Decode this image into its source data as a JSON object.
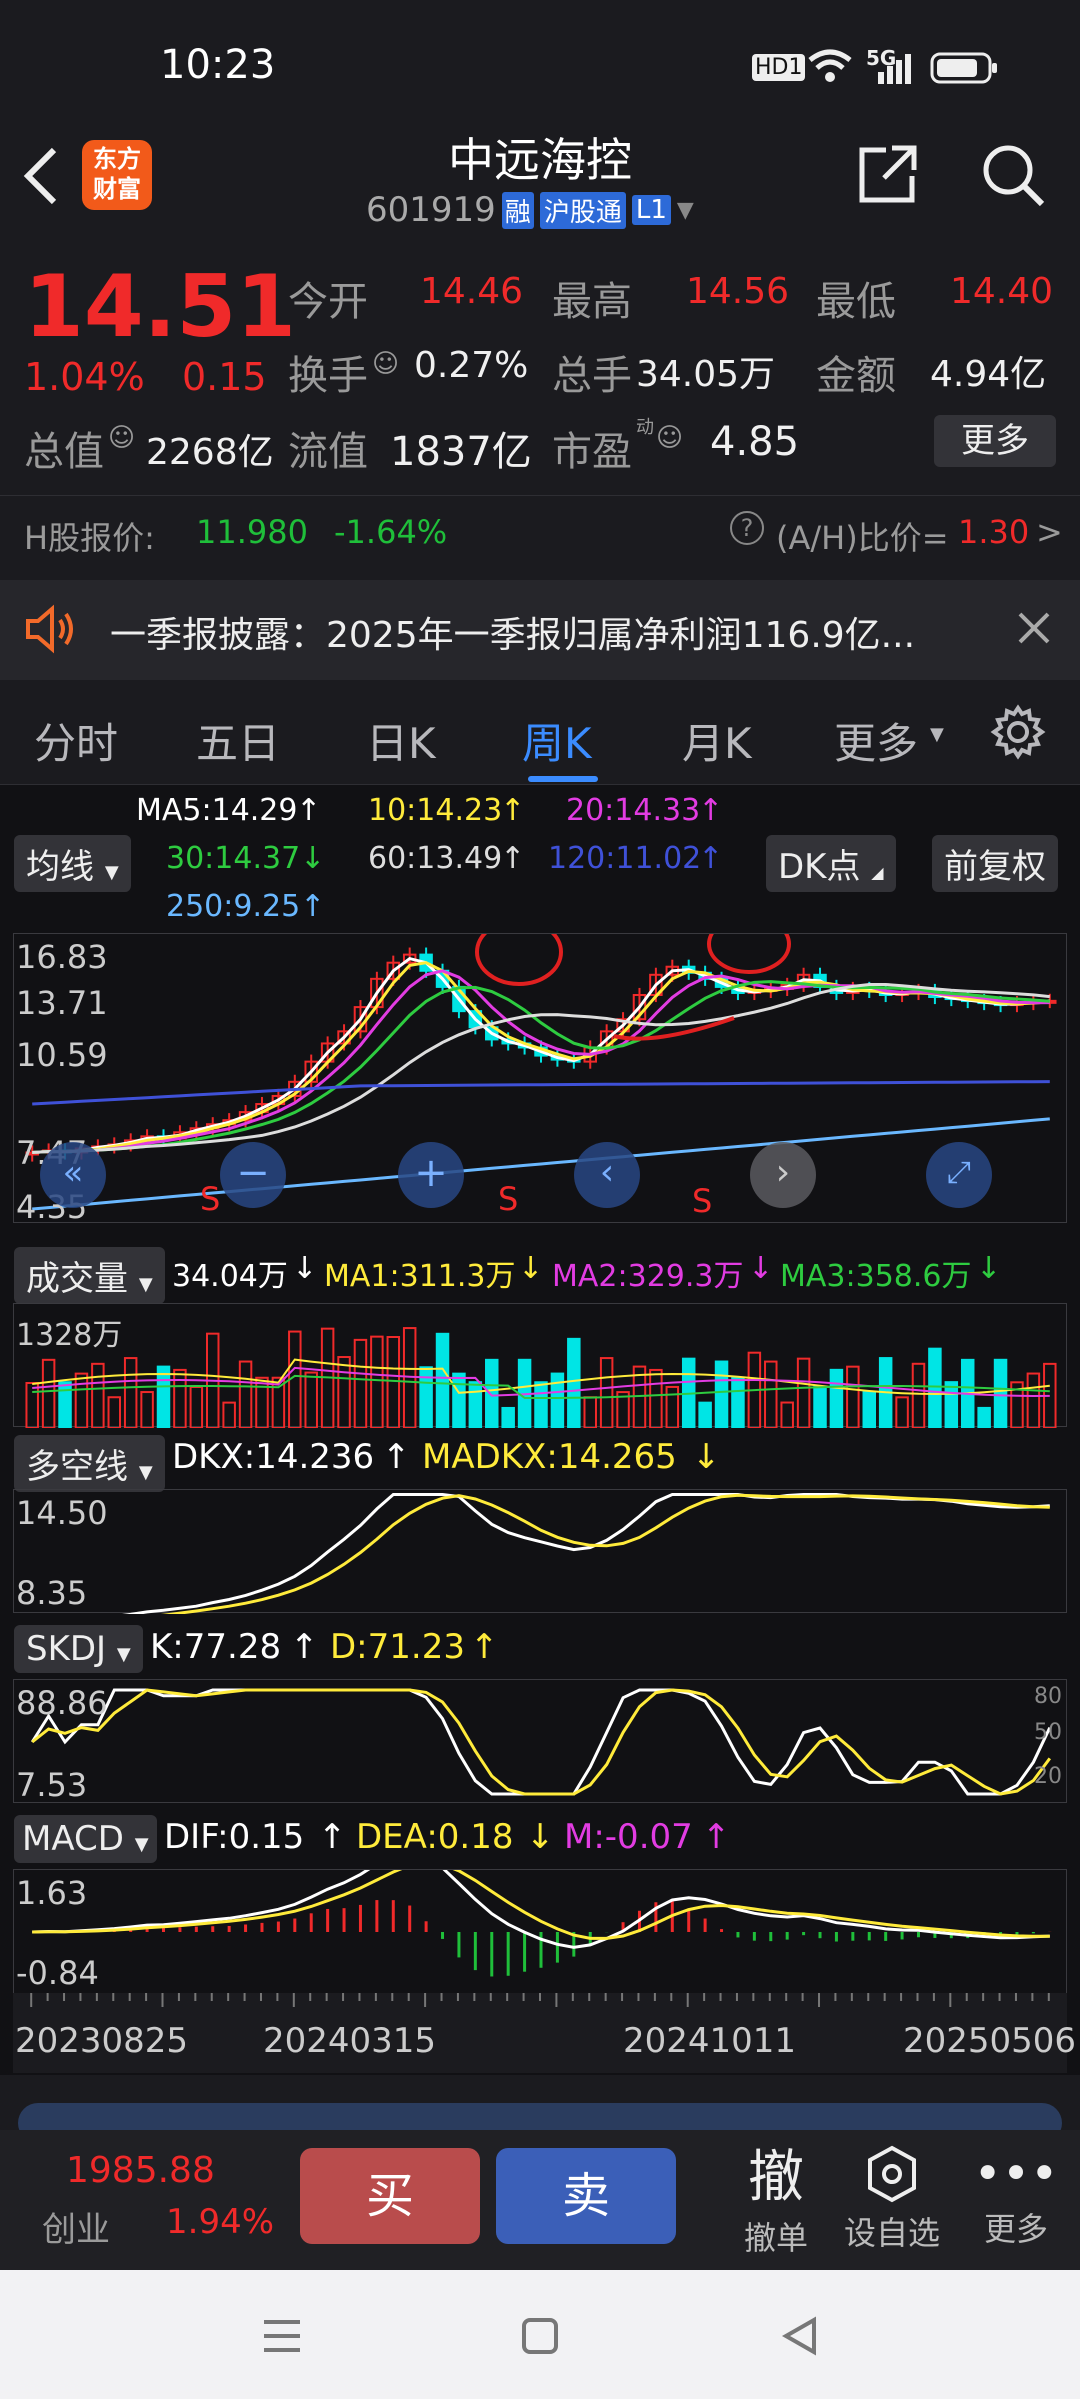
{
  "status_bar": {
    "time": "10:23",
    "hd": "HD1",
    "net": "5G"
  },
  "header": {
    "title": "中远海控",
    "code": "601919",
    "badge_rong": "融",
    "badge_hgt": "沪股通",
    "badge_level": "L1",
    "logo_line1": "东方",
    "logo_line2": "财富"
  },
  "quote": {
    "price": "14.51",
    "change_pct": "1.04%",
    "change": "0.15",
    "open_label": "今开",
    "open": "14.46",
    "high_label": "最高",
    "high": "14.56",
    "low_label": "最低",
    "low": "14.40",
    "turnover_label": "换手",
    "turnover": "0.27%",
    "volume_label": "总手",
    "volume": "34.05万",
    "amount_label": "金额",
    "amount": "4.94亿",
    "mcap_label": "总值",
    "mcap": "2268亿",
    "float_label": "流值",
    "float": "1837亿",
    "pe_label": "市盈",
    "pe_sup": "动",
    "pe": "4.85",
    "more_label": "更多"
  },
  "h_share": {
    "label": "H股报价:",
    "price": "11.980",
    "pct": "-1.64%",
    "ah_label": "(A/H)比价=",
    "ah_value": "1.30",
    "arrow": ">"
  },
  "notice": {
    "text": "一季报披露：2025年一季报归属净利润116.9亿..."
  },
  "tabs": [
    "分时",
    "五日",
    "日K",
    "周K",
    "月K",
    "更多"
  ],
  "active_tab": "周K",
  "ma_legend": {
    "ma5": "MA5:14.29",
    "ma10": "10:14.23",
    "ma20": "20:14.33",
    "ma30": "30:14.37",
    "ma60": "60:13.49",
    "ma120": "120:11.02",
    "ma250": "250:9.25"
  },
  "selectors": {
    "ma_type": "均线",
    "dk": "DK点",
    "fq": "前复权",
    "vol": "成交量",
    "dkx": "多空线",
    "skdj": "SKDJ",
    "macd": "MACD"
  },
  "colors": {
    "up": "#f02a2a",
    "down": "#00e5e5",
    "ma5": "#ffffff",
    "ma10": "#ffeb3b",
    "ma20": "#e23ce2",
    "ma30": "#2ecc40",
    "ma60": "#dddddd",
    "ma120": "#3f51d8",
    "ma250": "#6ab8ff",
    "active": "#3b8cff"
  },
  "kchart": {
    "y_labels": [
      "16.83",
      "13.71",
      "10.59",
      "7.47",
      "4.35"
    ],
    "s_marker": "S"
  },
  "volume": {
    "value": "34.04万",
    "ma1": "MA1:311.3万",
    "ma2": "MA2:329.3万",
    "ma3": "MA3:358.6万",
    "y_label": "1328万"
  },
  "dkx": {
    "dkx": "DKX:14.236",
    "madkx": "MADKX:14.265",
    "y_top": "14.50",
    "y_bottom": "8.35"
  },
  "skdj": {
    "k": "K:77.28",
    "d": "D:71.23",
    "y_top": "88.86",
    "y_bottom": "7.53",
    "r80": "80",
    "r50": "50",
    "r20": "20"
  },
  "macd": {
    "dif": "DIF:0.15",
    "dea": "DEA:0.18",
    "m": "M:-0.07",
    "y_top": "1.63",
    "y_bottom": "-0.84"
  },
  "dates": [
    "20230825",
    "20240315",
    "20241011",
    "20250506"
  ],
  "trade": {
    "index_value": "1985.88",
    "index_name": "创业",
    "index_pct": "1.94%",
    "buy": "买",
    "sell": "卖",
    "cancel_big": "撤",
    "cancel": "撤单",
    "watch": "设自选",
    "more": "更多"
  },
  "chart_data": {
    "type": "candlestick",
    "title": "中远海控 周K",
    "y_ticks": [
      16.83,
      13.71,
      10.59,
      7.47,
      4.35
    ],
    "x_ticks": [
      "20230825",
      "20240315",
      "20241011",
      "20250506"
    ],
    "close": [
      7.0,
      7.1,
      7.0,
      7.2,
      7.3,
      7.4,
      7.6,
      7.8,
      7.7,
      8.0,
      8.2,
      8.4,
      8.6,
      9.0,
      9.4,
      9.8,
      10.5,
      11.5,
      12.4,
      13.0,
      14.2,
      15.6,
      16.4,
      16.8,
      16.0,
      15.2,
      14.0,
      13.2,
      12.6,
      12.4,
      12.2,
      11.8,
      11.6,
      11.5,
      12.2,
      13.0,
      13.6,
      14.8,
      15.8,
      16.2,
      15.9,
      15.6,
      15.2,
      14.9,
      15.0,
      15.1,
      15.3,
      15.8,
      15.2,
      14.9,
      15.1,
      15.0,
      14.8,
      14.9,
      15.0,
      14.7,
      14.6,
      14.5,
      14.4,
      14.3,
      14.4,
      14.5,
      14.51
    ]
  }
}
